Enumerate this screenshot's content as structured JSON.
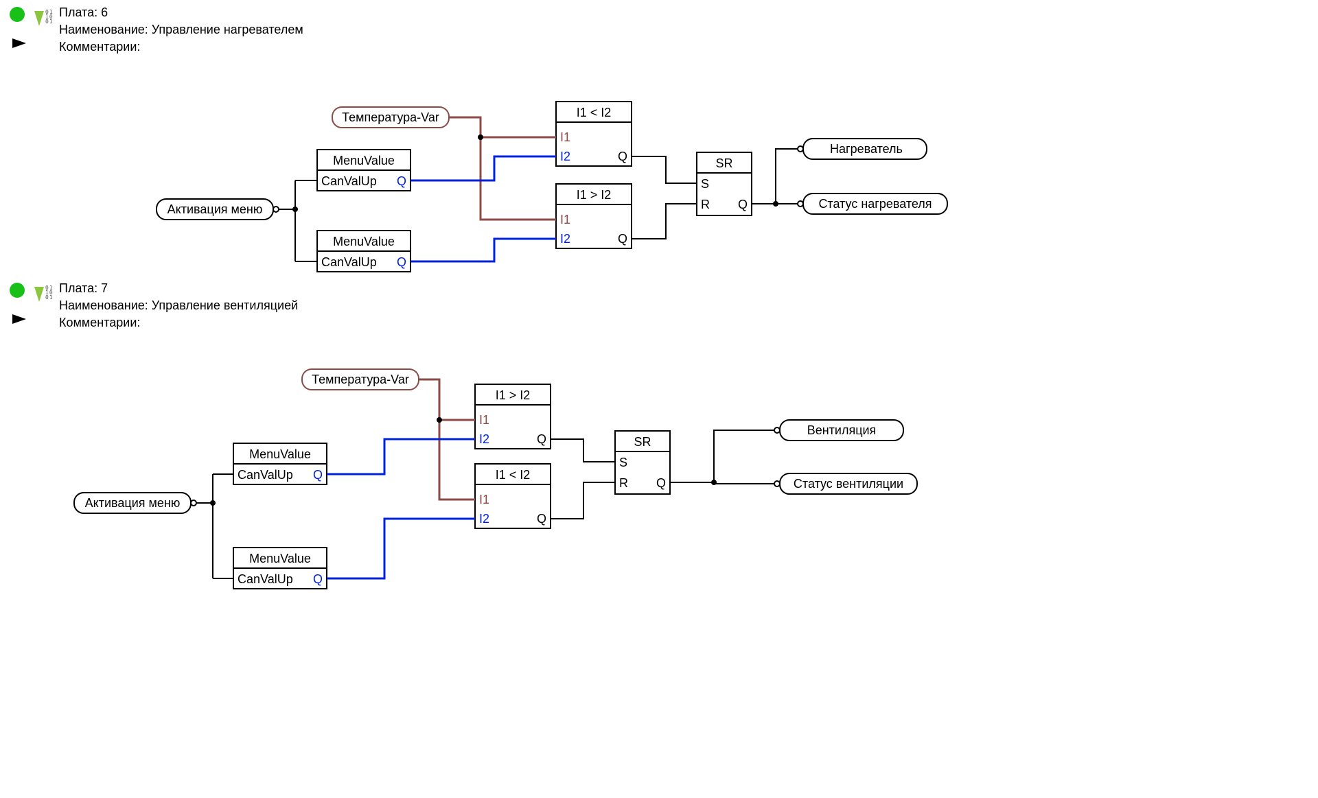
{
  "sections": [
    {
      "header": {
        "plate_label": "Плата:",
        "plate_value": "6",
        "name_label": "Наименование:",
        "name_value": "Управление нагревателем",
        "comments_label": "Комментарии:"
      },
      "blocks": {
        "temp_var": "Температура-Var",
        "menu_activation": "Активация  меню",
        "menu_value": "MenuValue",
        "can_val_up": "CanValUp",
        "q": "Q",
        "cmp_lt": "I1 < I2",
        "cmp_gt": "I1 > I2",
        "i1": "I1",
        "i2": "I2",
        "sr": "SR",
        "s": "S",
        "r": "R",
        "out1": "Нагреватель",
        "out2": "Статус нагревателя"
      }
    },
    {
      "header": {
        "plate_label": "Плата:",
        "plate_value": "7",
        "name_label": "Наименование:",
        "name_value": "Управление вентиляцией",
        "comments_label": "Комментарии:"
      },
      "blocks": {
        "temp_var": "Температура-Var",
        "menu_activation": "Активация  меню",
        "menu_value": "MenuValue",
        "can_val_up": "CanValUp",
        "q": "Q",
        "cmp_gt": "I1 > I2",
        "cmp_lt": "I1 < I2",
        "i1": "I1",
        "i2": "I2",
        "sr": "SR",
        "s": "S",
        "r": "R",
        "out1": "Вентиляция",
        "out2": "Статус вентиляции"
      }
    }
  ]
}
